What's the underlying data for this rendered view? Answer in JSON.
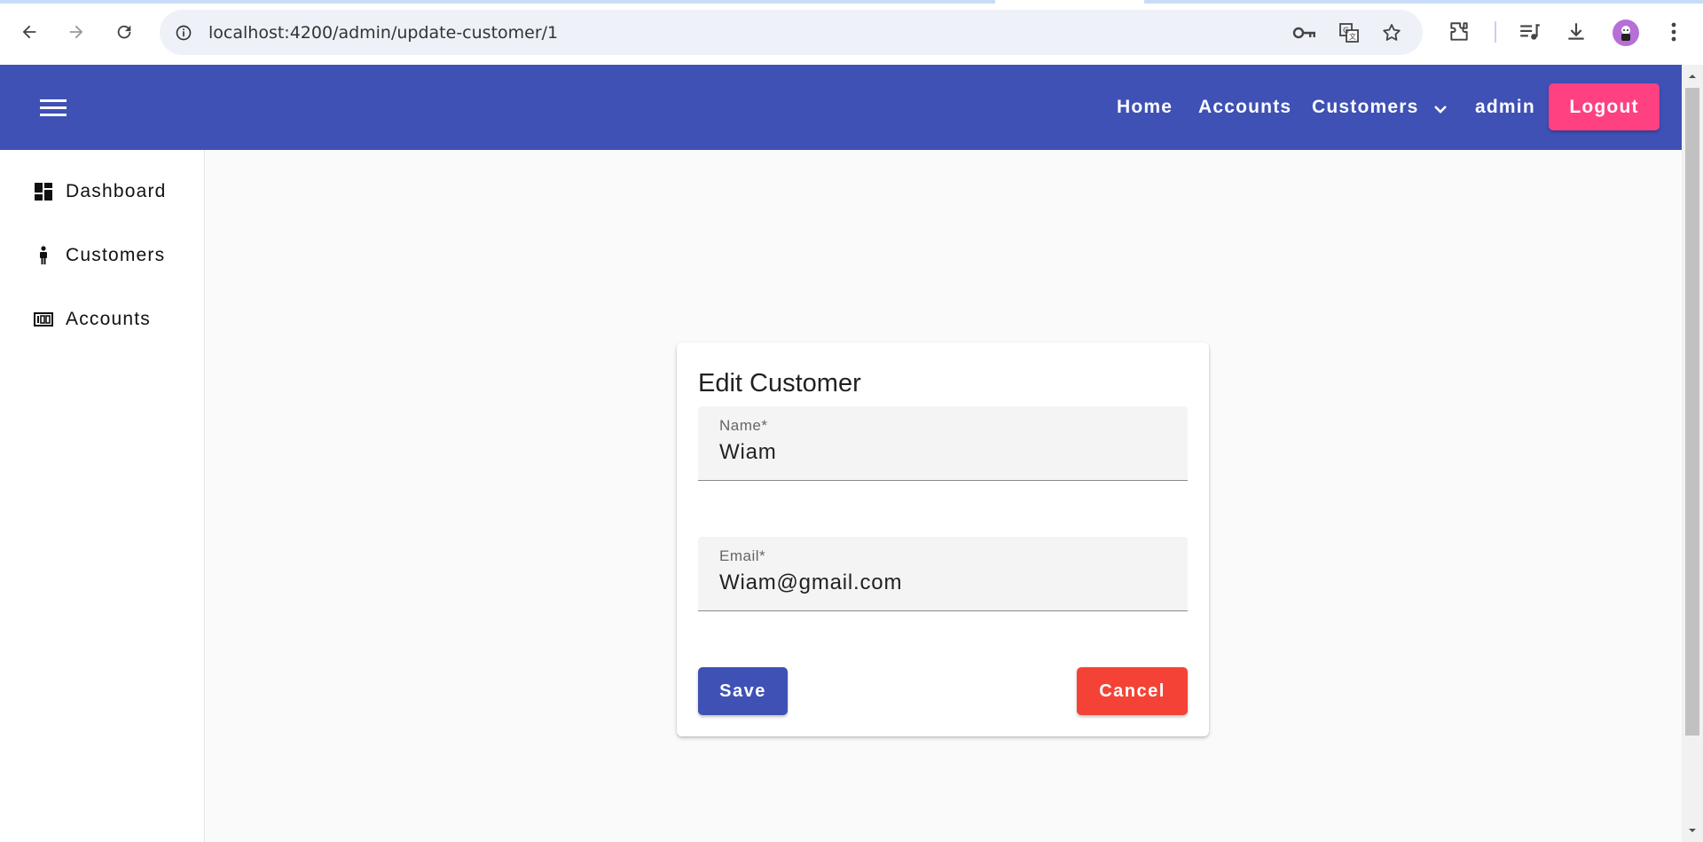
{
  "browser": {
    "url": "localhost:4200/admin/update-customer/1",
    "icons": [
      "back-arrow-icon",
      "forward-arrow-icon",
      "reload-icon",
      "site-info-icon",
      "key-icon",
      "translate-icon",
      "star-icon",
      "extensions-icon",
      "media-queue-icon",
      "download-icon",
      "profile-avatar-icon",
      "kebab-menu-icon"
    ]
  },
  "toolbar": {
    "nav": {
      "home": "Home",
      "accounts": "Accounts",
      "customers": "Customers",
      "user": "admin",
      "logout": "Logout"
    },
    "colors": {
      "primary": "#3f51b5",
      "accent": "#ff4081"
    }
  },
  "sidebar": {
    "items": [
      {
        "label": "Dashboard",
        "icon": "dashboard-icon"
      },
      {
        "label": "Customers",
        "icon": "person-icon"
      },
      {
        "label": "Accounts",
        "icon": "pin-icon"
      }
    ]
  },
  "form": {
    "title": "Edit Customer",
    "name_label": "Name*",
    "name_value": "Wiam",
    "email_label": "Email*",
    "email_value": "Wiam@gmail.com",
    "save_label": "Save",
    "cancel_label": "Cancel",
    "colors": {
      "save": "#3f51b5",
      "cancel": "#f44336"
    }
  }
}
